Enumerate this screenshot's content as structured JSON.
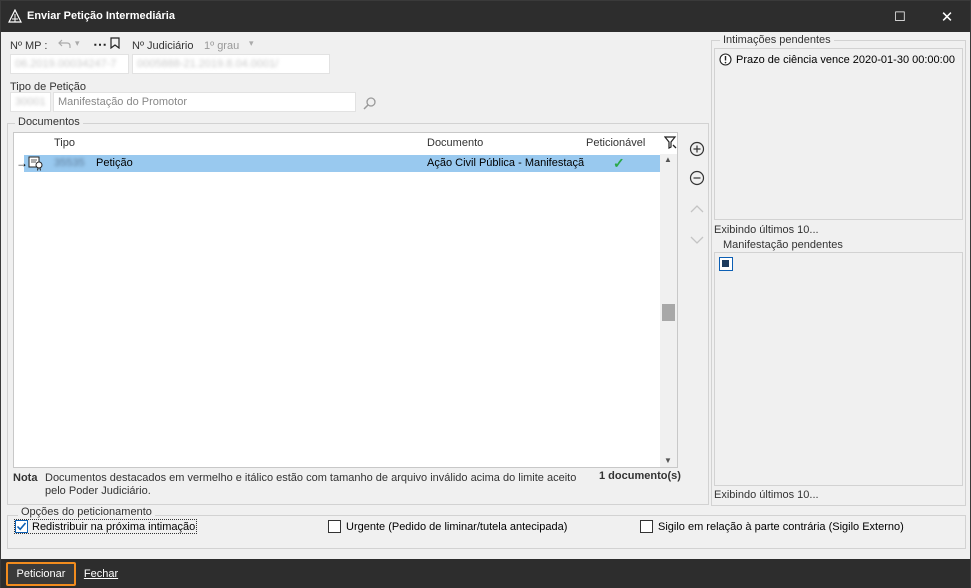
{
  "window": {
    "title": "Enviar Petição Intermediária",
    "close_glyph": "✕",
    "maximize_glyph": "☐"
  },
  "header": {
    "mp_label": "Nº MP :",
    "mp_value": "06.2019.00034247-7",
    "judiciario_label": "Nº Judiciário",
    "judiciario_grade": "1º grau",
    "judiciario_value": "0005888-21.2019.8.04.0001/"
  },
  "tipo_peticao": {
    "label": "Tipo de Petição",
    "code": "30001",
    "value": "Manifestação do Promotor"
  },
  "documentos": {
    "title": "Documentos",
    "columns": {
      "tipo": "Tipo",
      "documento": "Documento",
      "peticionavel": "Peticionável"
    },
    "row": {
      "code": "35535",
      "tipo": "Petição",
      "documento": "Ação Civil Pública - Manifestaçã",
      "peticionavel_check": "✓"
    },
    "nota_label": "Nota",
    "nota_text": "Documentos destacados em vermelho e itálico estão com tamanho de arquivo inválido acima do limite aceito pelo Poder Judiciário.",
    "count": "1 documento(s)"
  },
  "intimacoes": {
    "title": "Intimações pendentes",
    "item": "Prazo de ciência vence 2020-01-30 00:00:00",
    "footer": "Exibindo últimos 10..."
  },
  "manifestacao": {
    "title": "Manifestação pendentes",
    "footer": "Exibindo últimos 10..."
  },
  "opcoes": {
    "title": "Opções do peticionamento",
    "redistribuir": "Redistribuir na próxima intimação",
    "urgente": "Urgente (Pedido de liminar/tutela antecipada)",
    "sigilo": "Sigilo em relação à parte contrária (Sigilo Externo)"
  },
  "footer": {
    "peticionar": "Peticionar",
    "fechar": "Fechar"
  },
  "colors": {
    "accent": "#f28c1e",
    "selection": "#99c9ef",
    "check_green": "#2aa84a",
    "titlebar": "#2d2d2d"
  }
}
